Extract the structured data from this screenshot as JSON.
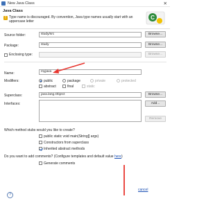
{
  "window": {
    "title": "New Java Class",
    "close_glyph": "✕"
  },
  "header": {
    "title": "Java Class",
    "warning_glyph": "!",
    "warning": "Type name is discouraged. By convention, Java type names usually start with an uppercase letter"
  },
  "form": {
    "source_folder": {
      "label": "Source folder:",
      "value": "study/src",
      "button": "Browse..."
    },
    "package": {
      "label": "Package:",
      "value": "study",
      "button": "Browse..."
    },
    "enclosing_type": {
      "label": "Enclosing type:",
      "value": "",
      "button": "Browse..."
    },
    "name": {
      "label": "Name:",
      "value": "myjava"
    },
    "modifiers": {
      "label": "Modifiers:",
      "row1": [
        "public",
        "package",
        "private",
        "protected"
      ],
      "row2": [
        "abstract",
        "final",
        "static"
      ]
    },
    "superclass": {
      "label": "Superclass:",
      "value": "java.lang.Object",
      "button": "Browse..."
    },
    "interfaces": {
      "label": "Interfaces:",
      "add_button": "Add...",
      "remove_button": "Remove"
    }
  },
  "stubs": {
    "question": "Which method stubs would you like to create?",
    "options": [
      "public static void main(String[] args)",
      "Constructors from superclass",
      "Inherited abstract methods"
    ]
  },
  "comments": {
    "question": "Do you want to add comments? (Configure templates and default value",
    "link": "here",
    "tail": ")",
    "option": "Generate comments"
  },
  "footer": {
    "help_glyph": "?",
    "cancel_link": "cancel"
  },
  "colors": {
    "annotation_red": "#e8352e",
    "link_blue": "#1a4fb3",
    "accent_blue": "#1f5fbf"
  }
}
